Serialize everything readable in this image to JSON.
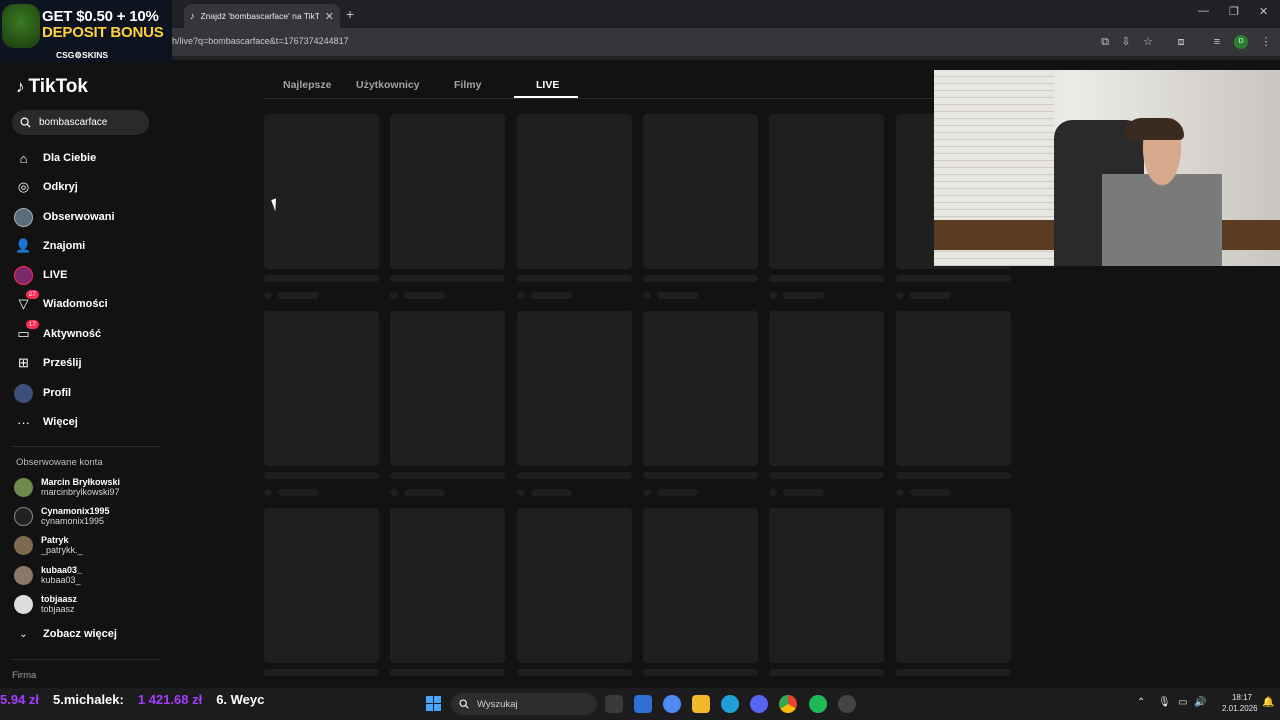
{
  "browser": {
    "tab_title": "Znajdź 'bombascarface' na TikTok",
    "url": "h/live?q=bombascarface&t=1767374244817",
    "profile_initial": "D"
  },
  "ad": {
    "line1": "GET $0.50 + 10%",
    "line2": "DEPOSIT BONUS",
    "brand": "CSG⚙SKINS"
  },
  "tiktok": {
    "logo_text": "TikTok",
    "search_value": "bombascarface",
    "nav": [
      {
        "label": "Dla Ciebie",
        "icon": "home-icon"
      },
      {
        "label": "Odkryj",
        "icon": "compass-icon"
      },
      {
        "label": "Obserwowani",
        "icon": "avatar-icon"
      },
      {
        "label": "Znajomi",
        "icon": "friends-icon"
      },
      {
        "label": "LIVE",
        "icon": "live-icon"
      },
      {
        "label": "Wiadomości",
        "icon": "send-icon",
        "badge": "27"
      },
      {
        "label": "Aktywność",
        "icon": "activity-icon",
        "badge": "17"
      },
      {
        "label": "Prześlij",
        "icon": "upload-icon"
      },
      {
        "label": "Profil",
        "icon": "profile-icon"
      },
      {
        "label": "Więcej",
        "icon": "more-icon"
      }
    ],
    "followed_header": "Obserwowane konta",
    "followed": [
      {
        "name": "Marcin Bryłkowski",
        "handle": "marcinbrylkowski97"
      },
      {
        "name": "Cynamonix1995",
        "handle": "cynamonix1995"
      },
      {
        "name": "Patryk",
        "handle": "_patrykk._"
      },
      {
        "name": "kubaa03_",
        "handle": "kubaa03_"
      },
      {
        "name": "tobjaasz",
        "handle": "tobjaasz"
      }
    ],
    "see_more": "Zobacz więcej",
    "footer": "Firma",
    "tabs": [
      {
        "label": "Najlepsze"
      },
      {
        "label": "Użytkownicy"
      },
      {
        "label": "Filmy"
      },
      {
        "label": "LIVE"
      }
    ]
  },
  "taskbar": {
    "ticker": [
      "5.94 zł",
      "5.michalek:",
      "1 421.68 zł",
      "6. Weyc"
    ],
    "search_placeholder": "Wyszukaj",
    "time": "18:17",
    "date": "2.01.2026"
  },
  "colors": {
    "accent_pink": "#fe2c55",
    "ad_yellow": "#ffd23a",
    "ticker_purple": "#a63cff"
  }
}
